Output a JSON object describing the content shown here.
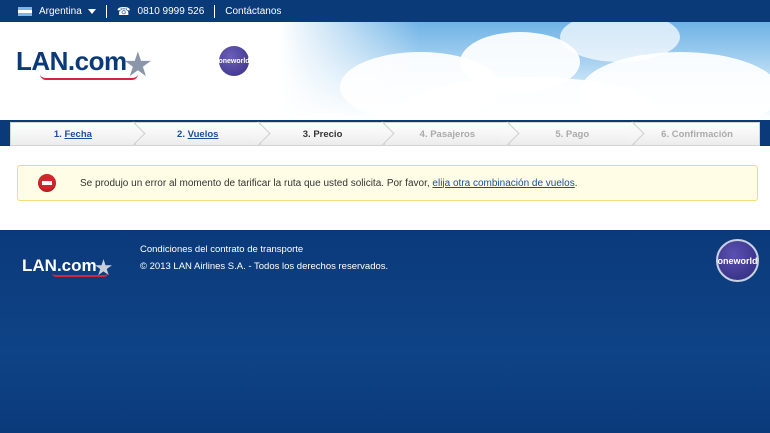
{
  "topbar": {
    "country": "Argentina",
    "phone_icon": "☎",
    "phone": "0810 9999 526",
    "contact": "Contáctanos"
  },
  "header": {
    "logo_text": "LAN.com",
    "star": "★",
    "oneworld": "oneworld"
  },
  "steps": [
    {
      "num": "1.",
      "label": "Fecha"
    },
    {
      "num": "2.",
      "label": "Vuelos"
    },
    {
      "num": "",
      "label": "3. Precio"
    },
    {
      "num": "",
      "label": "4. Pasajeros"
    },
    {
      "num": "",
      "label": "5. Pago"
    },
    {
      "num": "",
      "label": "6. Confirmación"
    }
  ],
  "error": {
    "text": "Se produjo un error al momento de tarificar la ruta que usted solicita. Por favor, ",
    "link": "elija otra combinación de vuelos",
    "end": "."
  },
  "footer": {
    "logo_text": "LAN.com",
    "star": "★",
    "conditions": "Condiciones del contrato de transporte",
    "copyright": "© 2013 LAN Airlines S.A. - Todos los derechos reservados.",
    "oneworld": "oneworld"
  },
  "colors": {
    "brand_blue": "#0a3a78",
    "link_blue": "#1b4e9b",
    "error_red": "#d3262c",
    "error_bg": "#fffde6"
  }
}
